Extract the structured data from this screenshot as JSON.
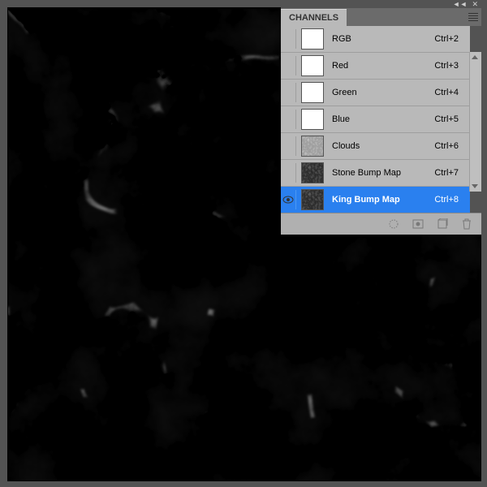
{
  "panel": {
    "tab": "CHANNELS",
    "channels": [
      {
        "name": "RGB",
        "shortcut": "Ctrl+2",
        "thumb": "white",
        "visible": false
      },
      {
        "name": "Red",
        "shortcut": "Ctrl+3",
        "thumb": "white",
        "visible": false
      },
      {
        "name": "Green",
        "shortcut": "Ctrl+4",
        "thumb": "white",
        "visible": false
      },
      {
        "name": "Blue",
        "shortcut": "Ctrl+5",
        "thumb": "white",
        "visible": false
      },
      {
        "name": "Clouds",
        "shortcut": "Ctrl+6",
        "thumb": "clouds",
        "visible": false
      },
      {
        "name": "Stone Bump Map",
        "shortcut": "Ctrl+7",
        "thumb": "bump",
        "visible": false
      },
      {
        "name": "King Bump Map",
        "shortcut": "Ctrl+8",
        "thumb": "bump",
        "visible": true,
        "selected": true
      }
    ]
  },
  "topbar": {
    "collapse": "◄◄",
    "close": "✕"
  }
}
